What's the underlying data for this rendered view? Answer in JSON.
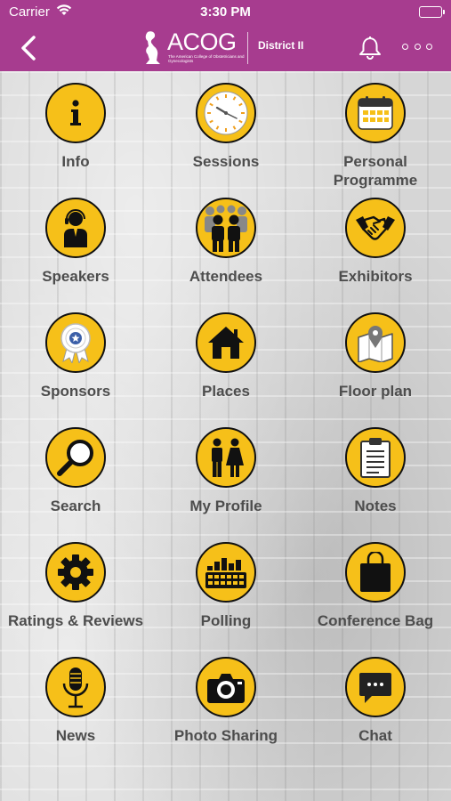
{
  "status_bar": {
    "carrier": "Carrier",
    "time": "3:30 PM"
  },
  "nav": {
    "logo_text": "ACOG",
    "logo_sub": "The American College of Obstetricians and Gynecologists",
    "district": "District II"
  },
  "colors": {
    "brand": "#a73c8f",
    "tile": "#f6c019",
    "label": "#4d4d4d"
  },
  "tiles": [
    {
      "label": "Info",
      "icon": "info-icon"
    },
    {
      "label": "Sessions",
      "icon": "clock-icon"
    },
    {
      "label": "Personal Programme",
      "icon": "calendar-icon"
    },
    {
      "label": "Speakers",
      "icon": "headset-person-icon"
    },
    {
      "label": "Attendees",
      "icon": "people-group-icon"
    },
    {
      "label": "Exhibitors",
      "icon": "handshake-icon"
    },
    {
      "label": "Sponsors",
      "icon": "award-ribbon-icon"
    },
    {
      "label": "Places",
      "icon": "home-icon"
    },
    {
      "label": "Floor plan",
      "icon": "map-pin-icon"
    },
    {
      "label": "Search",
      "icon": "magnifier-icon"
    },
    {
      "label": "My Profile",
      "icon": "man-woman-icon"
    },
    {
      "label": "Notes",
      "icon": "clipboard-icon"
    },
    {
      "label": "Ratings & Reviews",
      "icon": "gear-icon"
    },
    {
      "label": "Polling",
      "icon": "poll-bars-icon"
    },
    {
      "label": "Conference Bag",
      "icon": "bag-icon"
    },
    {
      "label": "News",
      "icon": "microphone-icon"
    },
    {
      "label": "Photo Sharing",
      "icon": "camera-icon"
    },
    {
      "label": "Chat",
      "icon": "chat-bubble-icon"
    }
  ]
}
